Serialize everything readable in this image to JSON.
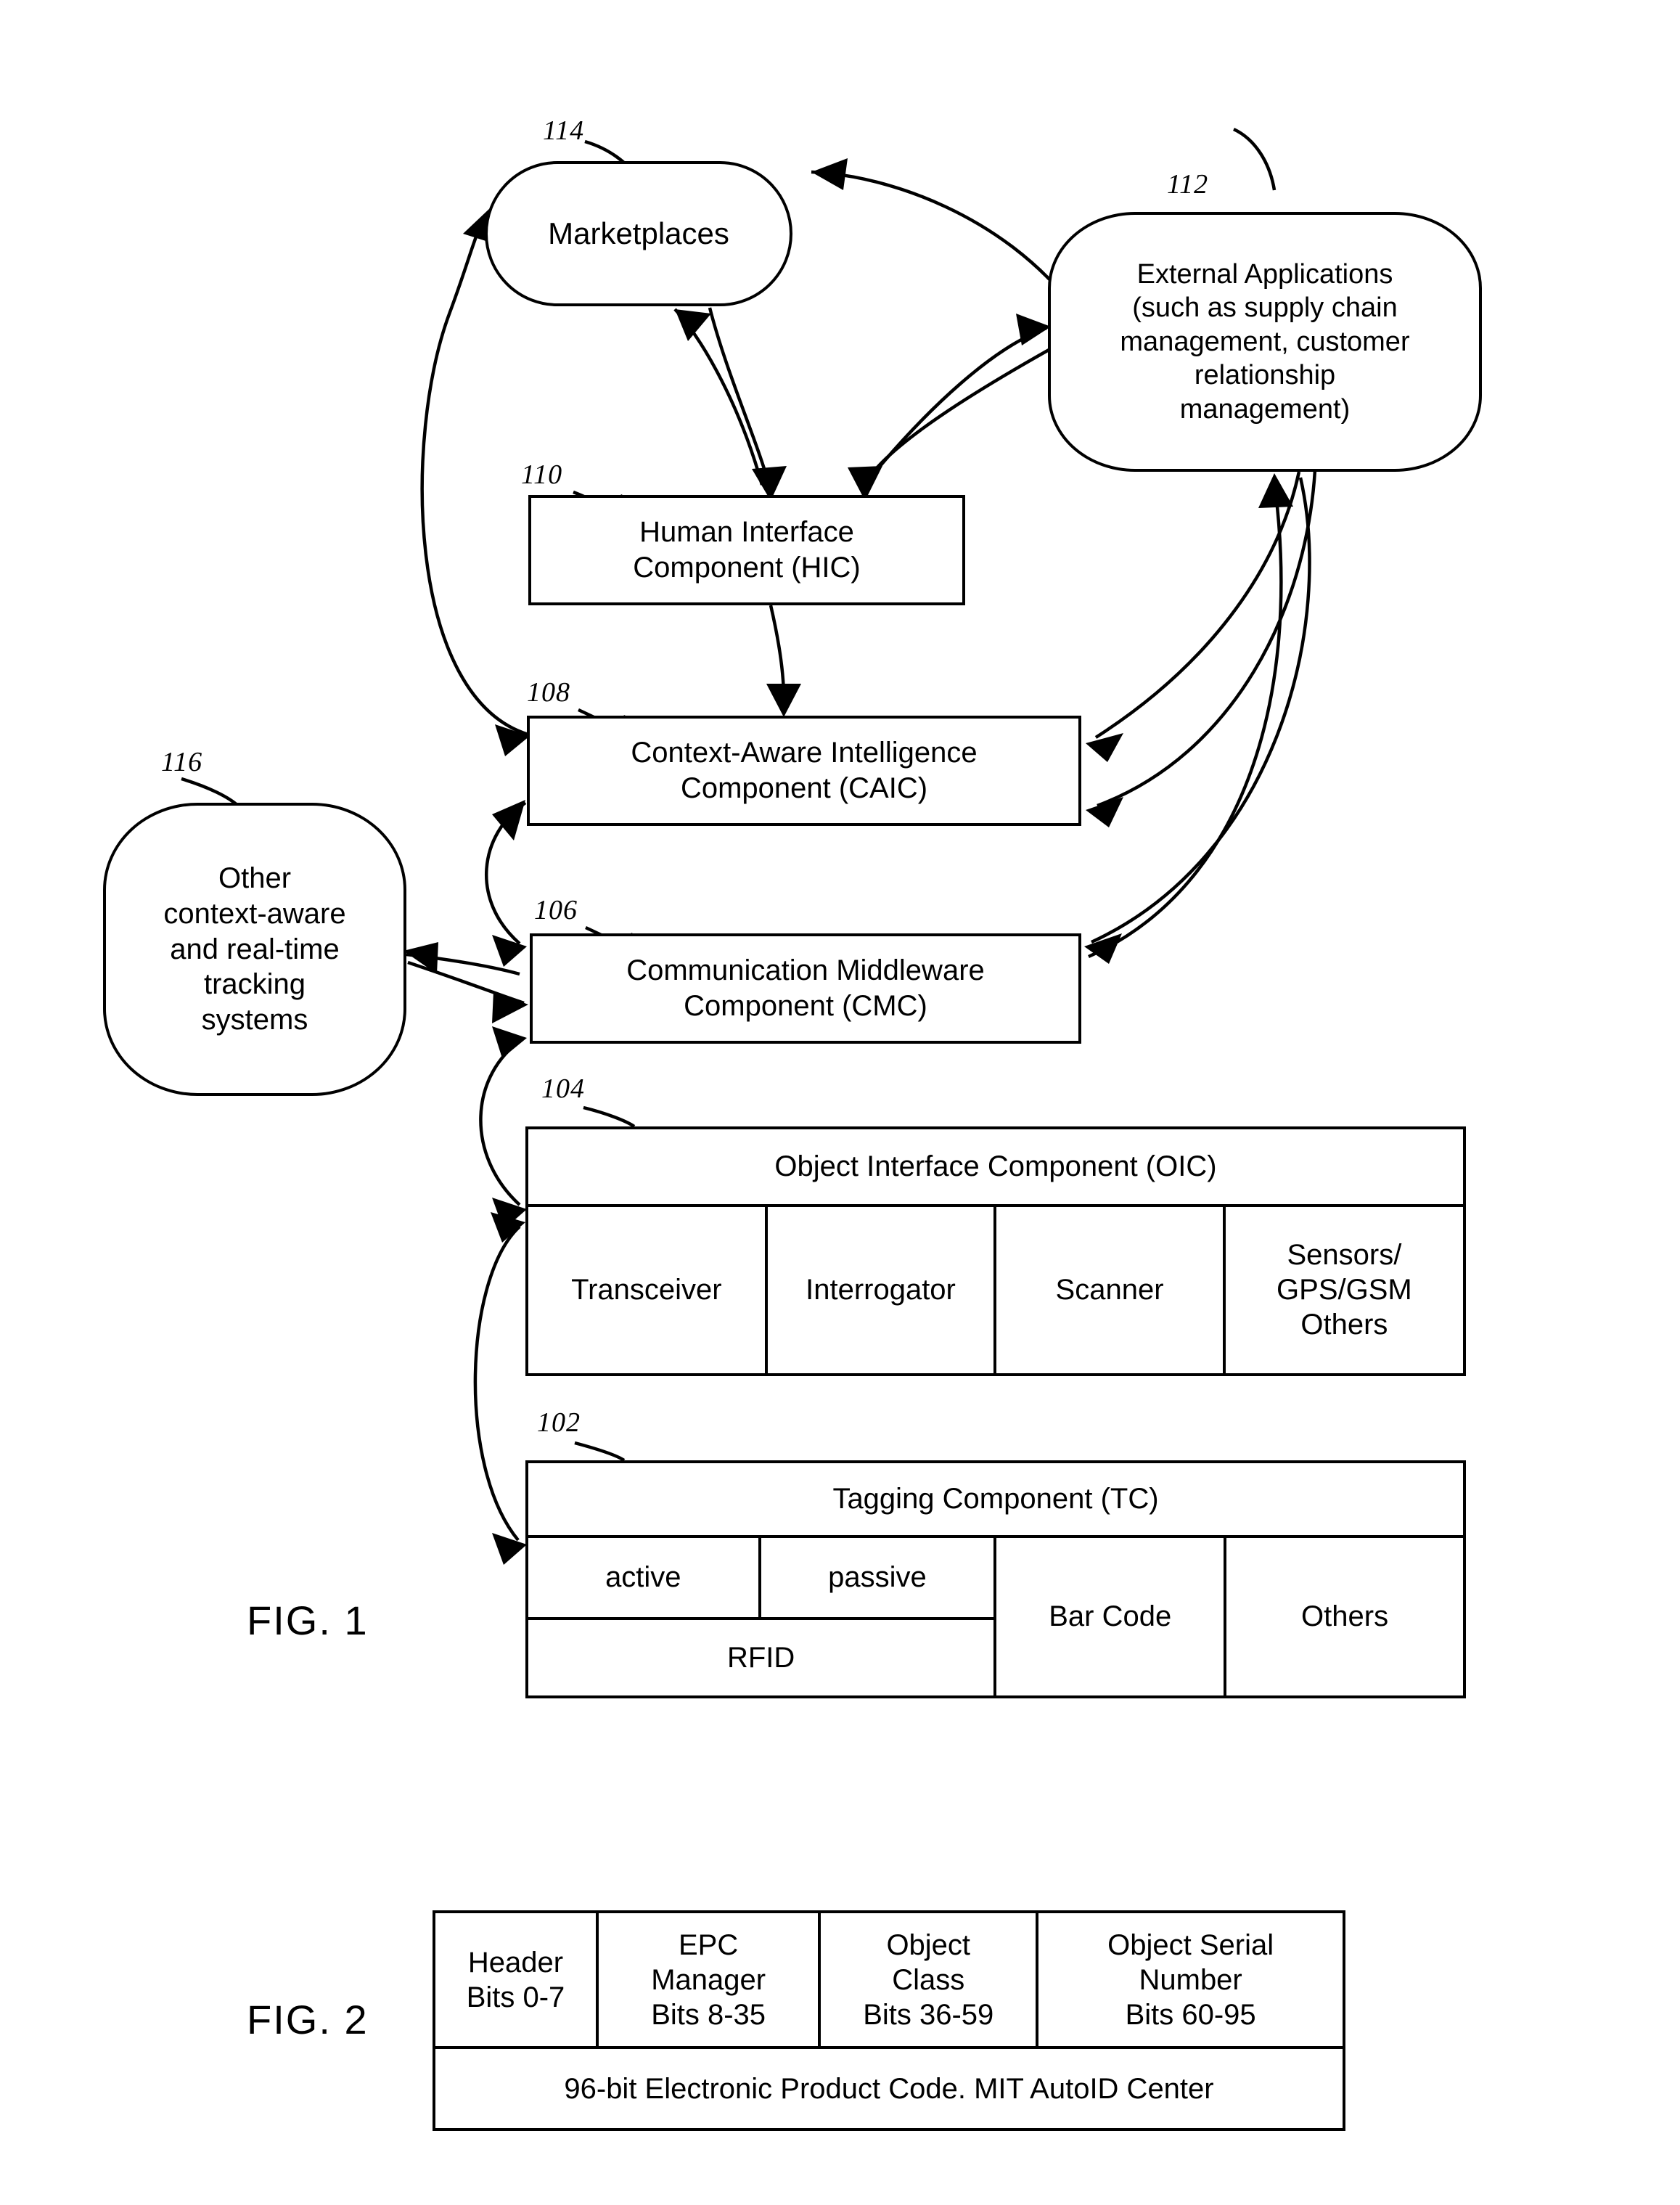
{
  "figures": [
    {
      "id": "fig1",
      "label": "FIG. 1"
    },
    {
      "id": "fig2",
      "label": "FIG. 2"
    }
  ],
  "fig1": {
    "label": "FIG. 1",
    "nodes": {
      "marketplaces": {
        "ref": "114",
        "text": "Marketplaces",
        "shape": "pill"
      },
      "external_apps": {
        "ref": "112",
        "text": "External Applications (such as supply chain management, customer relationship management)",
        "shape": "rounded",
        "lines": [
          "External Applications",
          "(such as supply chain",
          "management, customer",
          "relationship",
          "management)"
        ]
      },
      "hic": {
        "ref": "110",
        "text": "Human Interface Component (HIC)",
        "shape": "rect",
        "lines": [
          "Human Interface",
          "Component (HIC)"
        ]
      },
      "caic": {
        "ref": "108",
        "text": "Context-Aware Intelligence Component (CAIC)",
        "shape": "rect",
        "lines": [
          "Context-Aware Intelligence",
          "Component (CAIC)"
        ]
      },
      "cmc": {
        "ref": "106",
        "text": "Communication Middleware Component (CMC)",
        "shape": "rect",
        "lines": [
          "Communication Middleware",
          "Component (CMC)"
        ]
      },
      "other_systems": {
        "ref": "116",
        "text": "Other context-aware and real-time tracking systems",
        "shape": "rounded",
        "lines": [
          "Other",
          "context-aware",
          "and real-time",
          "tracking",
          "systems"
        ]
      },
      "oic": {
        "ref": "104",
        "title": "Object Interface Component (OIC)",
        "columns": [
          "Transceiver",
          "Interrogator",
          "Scanner",
          "Sensors/ GPS/GSM Others"
        ],
        "col4_lines": [
          "Sensors/",
          "GPS/GSM",
          "Others"
        ]
      },
      "tc": {
        "ref": "102",
        "title": "Tagging Component (TC)",
        "columns": [
          "active",
          "passive",
          "Bar Code",
          "Others"
        ],
        "span_label": "RFID"
      }
    }
  },
  "fig2": {
    "label": "FIG. 2",
    "table": {
      "columns": [
        {
          "name": "Header",
          "bits": "Bits 0-7",
          "name_lines": [
            "Header"
          ]
        },
        {
          "name": "EPC Manager",
          "bits": "Bits 8-35",
          "name_lines": [
            "EPC",
            "Manager"
          ]
        },
        {
          "name": "Object Class",
          "bits": "Bits 36-59",
          "name_lines": [
            "Object",
            "Class"
          ]
        },
        {
          "name": "Object Serial Number",
          "bits": "Bits 60-95",
          "name_lines": [
            "Object Serial",
            "Number"
          ]
        }
      ],
      "footer": "96-bit Electronic Product Code.  MIT AutoID Center"
    }
  },
  "colors": {
    "ink": "#000000",
    "paper": "#ffffff"
  }
}
